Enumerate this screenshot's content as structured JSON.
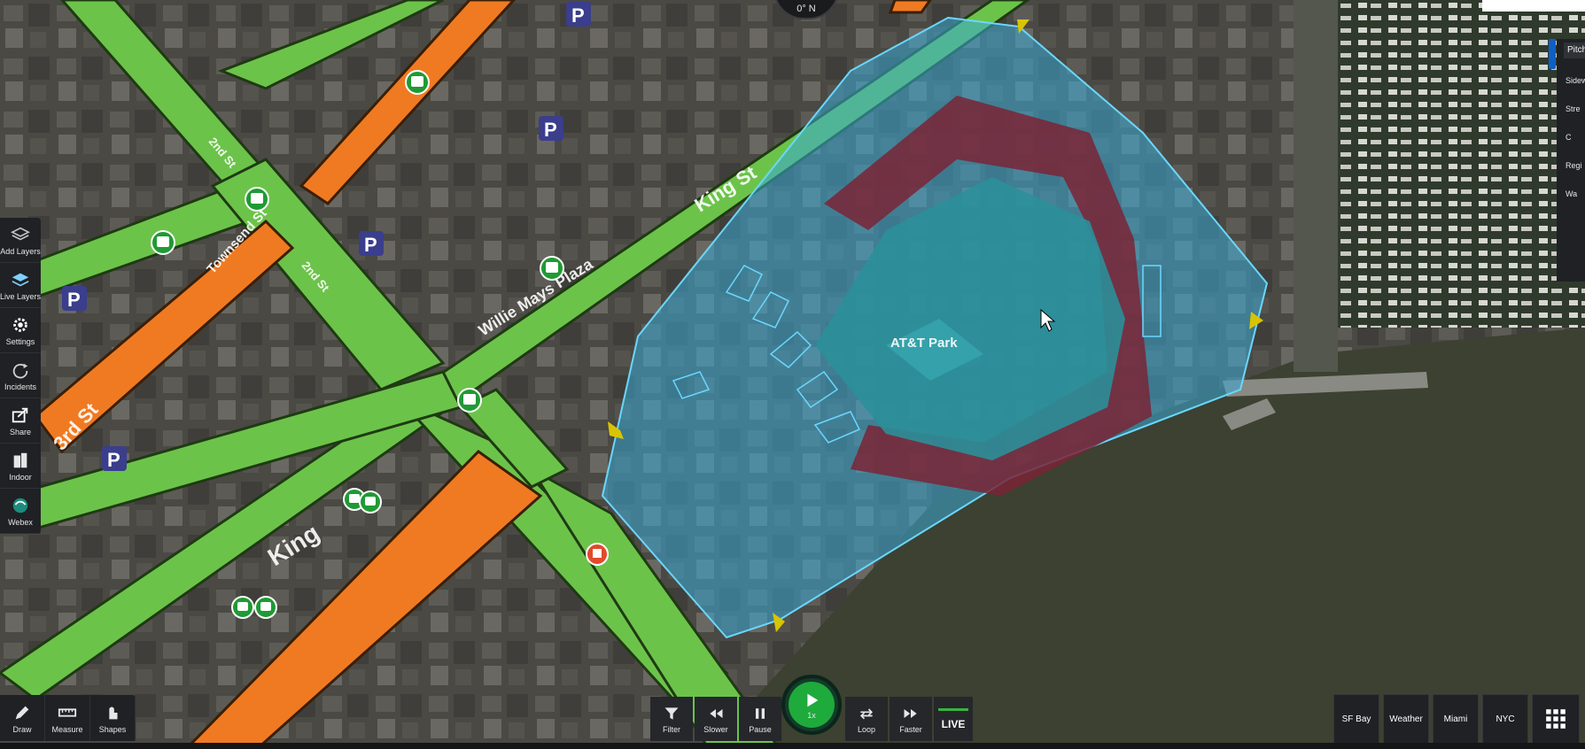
{
  "compass": {
    "heading": "0° N"
  },
  "map_labels": {
    "street_king": "King St",
    "plaza": "Willie Mays Plaza",
    "park": "AT&T Park",
    "townsend": "Townsend St",
    "second": "2nd St",
    "king_lower": "King",
    "third": "3rd St",
    "second_alt": "2nd St"
  },
  "left_toolbar": [
    {
      "label": "Add Layers",
      "icon": "add-layers-icon"
    },
    {
      "label": "Live Layers",
      "icon": "live-layers-icon"
    },
    {
      "label": "Settings",
      "icon": "gear-icon"
    },
    {
      "label": "Incidents",
      "icon": "incidents-icon"
    },
    {
      "label": "Share",
      "icon": "share-icon"
    },
    {
      "label": "Indoor",
      "icon": "building-icon"
    },
    {
      "label": "Webex",
      "icon": "webex-icon"
    }
  ],
  "bottom_tools": [
    {
      "label": "Draw",
      "icon": "pencil-icon"
    },
    {
      "label": "Measure",
      "icon": "ruler-icon"
    },
    {
      "label": "Shapes",
      "icon": "shapes-icon"
    }
  ],
  "playback": {
    "filter": "Filter",
    "slower": "Slower",
    "pause": "Pause",
    "speed": "1x",
    "loop": "Loop",
    "faster": "Faster",
    "live": "LIVE"
  },
  "regions": [
    "SF Bay",
    "Weather",
    "Miami",
    "NYC"
  ],
  "right_panel": {
    "title": "Pitch",
    "rows": [
      "Sidew",
      "Stre",
      "C",
      "Regi",
      "Wa"
    ]
  },
  "colors": {
    "street_green": "#6cc34a",
    "street_orange": "#f07a22",
    "stadium_zone": "#3aa9d6",
    "seating": "#7a2436",
    "water": "#3c4131",
    "play_button": "#1faa3c"
  }
}
